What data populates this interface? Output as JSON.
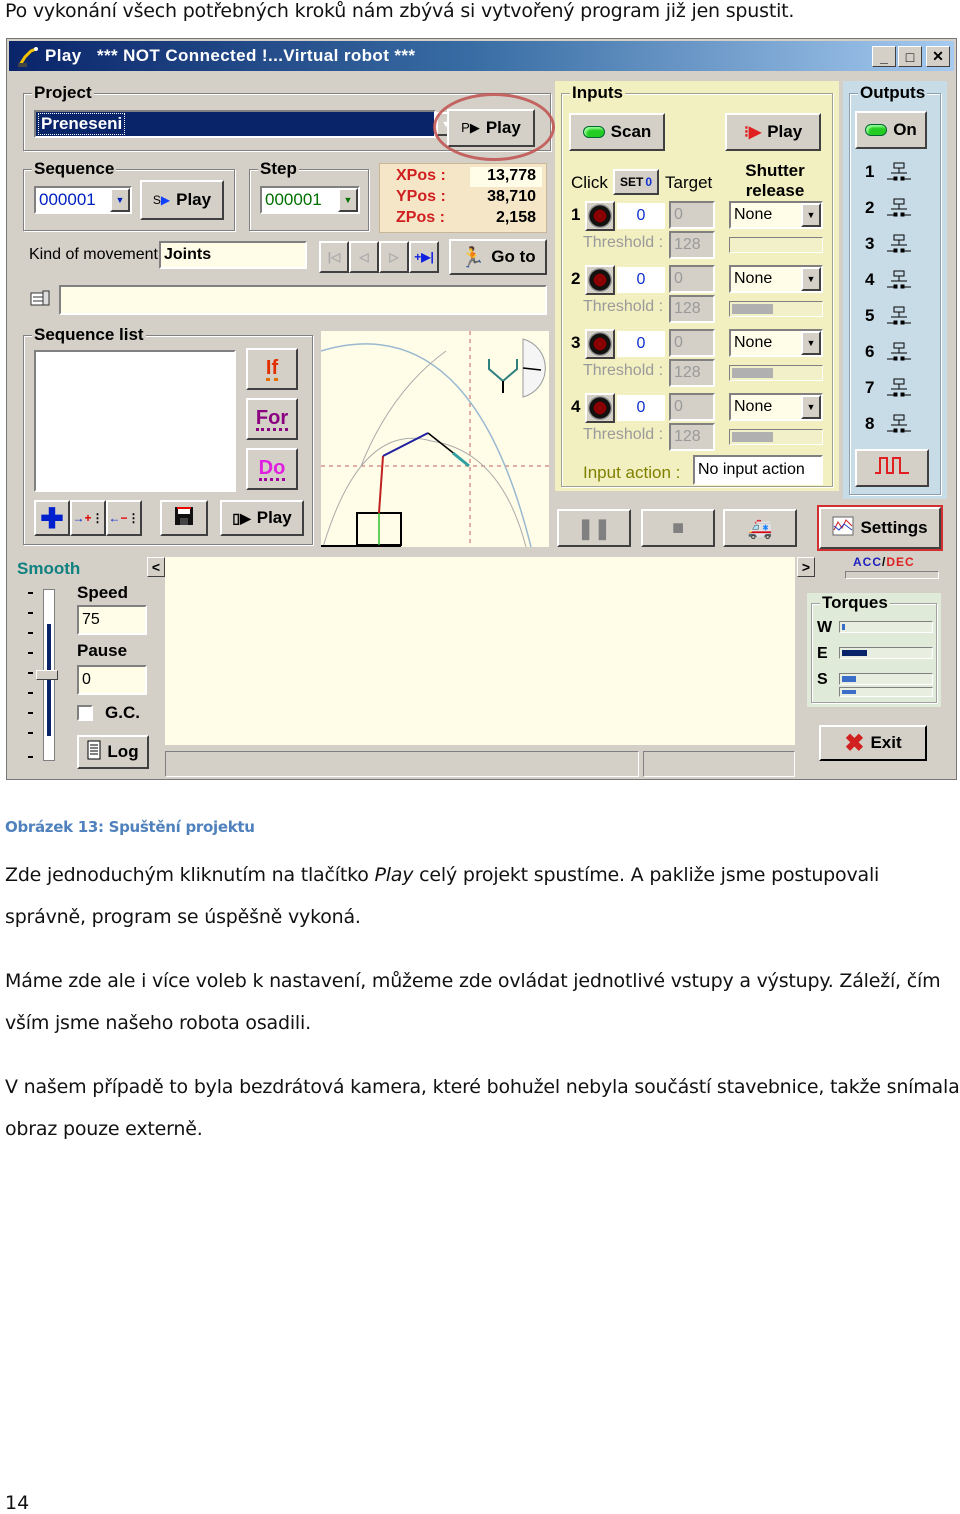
{
  "document": {
    "intro": "Po vykonání všech potřebných kroků nám zbývá si vytvořený program již jen spustit.",
    "caption": "Obrázek 13: Spuštění projektu",
    "paragraph1_a": "Zde jednoduchým kliknutím na tlačítko ",
    "paragraph1_em": "Play",
    "paragraph1_b": " celý projekt spustíme. A pakliže jsme postupovali",
    "paragraph1_line2": "správně, program se úspěšně vykoná.",
    "paragraph2_line1": "Máme zde ale i více voleb k nastavení, můžeme zde ovládat jednotlivé vstupy a výstupy. Záleží, čím",
    "paragraph2_line2": "vším jsme našeho robota osadili.",
    "paragraph3_line1": "V našem případě to byla bezdrátová kamera, které bohužel nebyla součástí stavebnice, takže snímala",
    "paragraph3_line2": "obraz pouze externě.",
    "page_number": "14"
  },
  "window": {
    "title": "Play   *** NOT Connected !...Virtual robot ***",
    "controls": {
      "minimize": "_",
      "maximize": "□",
      "close": "✕"
    },
    "highlight_color": "#c0504d"
  },
  "project": {
    "label": "Project",
    "selected": "Preneseni",
    "play_prefix": "P",
    "play_label": "Play"
  },
  "sequence": {
    "label": "Sequence",
    "selected": "000001",
    "play_prefix": "S",
    "play_label": "Play"
  },
  "step": {
    "label": "Step",
    "selected": "000001"
  },
  "position": {
    "x_label": "XPos :",
    "x_value": "13,778",
    "y_label": "YPos :",
    "y_value": "38,710",
    "z_label": "ZPos :",
    "z_value": "2,158"
  },
  "movement": {
    "label": "Kind of movement",
    "value": "Joints",
    "goto_label": "Go to",
    "comment_value": ""
  },
  "sequence_list": {
    "label": "Sequence list",
    "items": [],
    "if_label": "If",
    "for_label": "For",
    "do_label": "Do",
    "play_label": "Play"
  },
  "inputs": {
    "label": "Inputs",
    "scan_label": "Scan",
    "play_label": "Play",
    "click_label": "Click",
    "set0_label": "SET",
    "set0_value": "0",
    "target_label": "Target",
    "shutter_label_1": "Shutter",
    "shutter_label_2": "release",
    "threshold_label": "Threshold :",
    "rows": [
      {
        "num": "1",
        "value": "0",
        "target": "0",
        "threshold": "128",
        "shutter": "None",
        "level": 0
      },
      {
        "num": "2",
        "value": "0",
        "target": "0",
        "threshold": "128",
        "shutter": "None",
        "level": 0.45
      },
      {
        "num": "3",
        "value": "0",
        "target": "0",
        "threshold": "128",
        "shutter": "None",
        "level": 0.45
      },
      {
        "num": "4",
        "value": "0",
        "target": "0",
        "threshold": "128",
        "shutter": "None",
        "level": 0.45
      }
    ],
    "input_action_label": "Input action :",
    "input_action_value": "No input action"
  },
  "outputs": {
    "label": "Outputs",
    "on_label": "On",
    "items": [
      "1",
      "2",
      "3",
      "4",
      "5",
      "6",
      "7",
      "8"
    ]
  },
  "settings": {
    "label": "Settings",
    "acc_label": "ACC",
    "dec_label": "DEC",
    "slash": "/"
  },
  "smooth": {
    "label": "Smooth",
    "speed_label": "Speed",
    "speed_value": "75",
    "pause_label": "Pause",
    "pause_value": "0",
    "gc_label": "G.C.",
    "gc_checked": false,
    "log_label": "Log",
    "slider_level": 0.5
  },
  "torques": {
    "label": "Torques",
    "rows": [
      {
        "name": "W",
        "level": 0.03
      },
      {
        "name": "E",
        "level": 0.28
      },
      {
        "name": "S",
        "level": 0.15
      }
    ]
  },
  "exit_label": "Exit",
  "nav": {
    "left_arrow": "<",
    "right_arrow": ">"
  }
}
